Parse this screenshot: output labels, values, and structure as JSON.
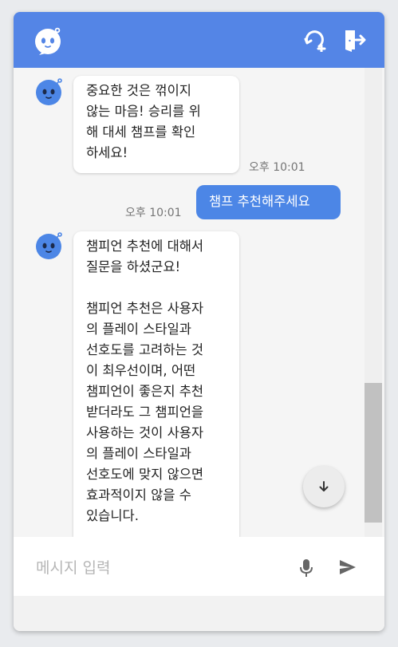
{
  "colors": {
    "header": "#5485e6",
    "user_bubble": "#4c86e6",
    "background": "#f5f5f5"
  },
  "header": {
    "logo_icon": "bot-face-icon",
    "new_chat_icon": "chat-refresh-icon",
    "exit_icon": "exit-door-icon"
  },
  "messages": [
    {
      "sender": "bot",
      "text": "중요한 것은 꺾이지\n않는 마음! 승리를 위\n해 대세 챔프를 확인\n하세요!",
      "time": "오후 10:01"
    },
    {
      "sender": "user",
      "text": "챔프 추천해주세요",
      "time": "오후 10:01"
    },
    {
      "sender": "bot",
      "text": "챔피언 추천에 대해서\n질문을 하셨군요!\n\n챔피언 추천은 사용자\n의 플레이 스타일과\n선호도를 고려하는 것\n이 최우선이며, 어떤\n챔피언이 좋은지 추천\n받더라도 그 챔피언을\n사용하는 것이 사용자\n의 플레이 스타일과\n선호도에 맞지 않으면\n효과적이지 않을 수\n있습니다.",
      "time": ""
    }
  ],
  "input": {
    "placeholder": "메시지 입력",
    "value": ""
  }
}
